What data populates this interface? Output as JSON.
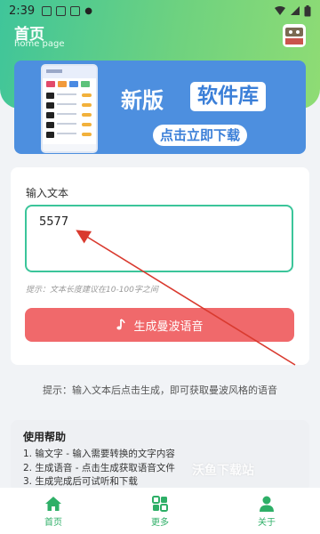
{
  "status_bar": {
    "time": "2:39"
  },
  "header": {
    "title": "首页",
    "subtitle": "home page",
    "logo_label": "全能曼波生成"
  },
  "banner": {
    "title_left": "新版",
    "title_right": "软件库",
    "cta": "点击立即下载",
    "bg_color": "#4d8fdf"
  },
  "form": {
    "label": "输入文本",
    "input_value": "5577",
    "hint": "提示：文本长度建议在10-100字之间",
    "generate_button": "生成曼波语音",
    "button_color": "#f0696b",
    "input_border_color": "#3bc59a"
  },
  "tip": "提示：输入文本后点击生成，即可获取曼波风格的语音",
  "help": {
    "title": "使用帮助",
    "steps": [
      "1. 输文字 - 输入需要转换的文字内容",
      "2. 生成语音 - 点击生成获取语音文件",
      "3. 生成完成后可试听和下载"
    ],
    "watermark": "沃鱼下载站"
  },
  "tabbar": {
    "items": [
      {
        "label": "首页",
        "icon": "home-icon"
      },
      {
        "label": "更多",
        "icon": "apps-icon"
      },
      {
        "label": "关于",
        "icon": "person-icon"
      }
    ],
    "active_color": "#2eaf67"
  }
}
